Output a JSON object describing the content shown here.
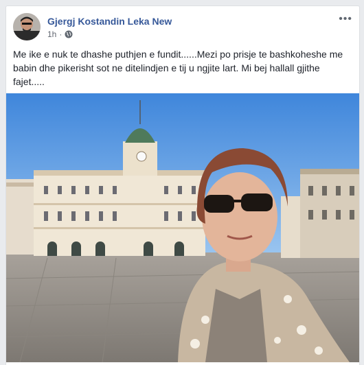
{
  "post": {
    "author": "Gjergj Kostandin Leka New",
    "time": "1h",
    "separator": "·",
    "privacy_icon": "globe-icon",
    "more_icon": "more-options-icon",
    "more_label": "•••",
    "text": "Me ike e nuk te dhashe puthjen e fundit......Mezi po prisje te bashkoheshe me babin dhe pikerisht sot ne ditelindjen e tij u ngjite lart. Mi bej hallall gjithe fajet....."
  },
  "colors": {
    "author_link": "#365899",
    "sky": "#4a90e2",
    "pavement": "#8f8a84"
  }
}
